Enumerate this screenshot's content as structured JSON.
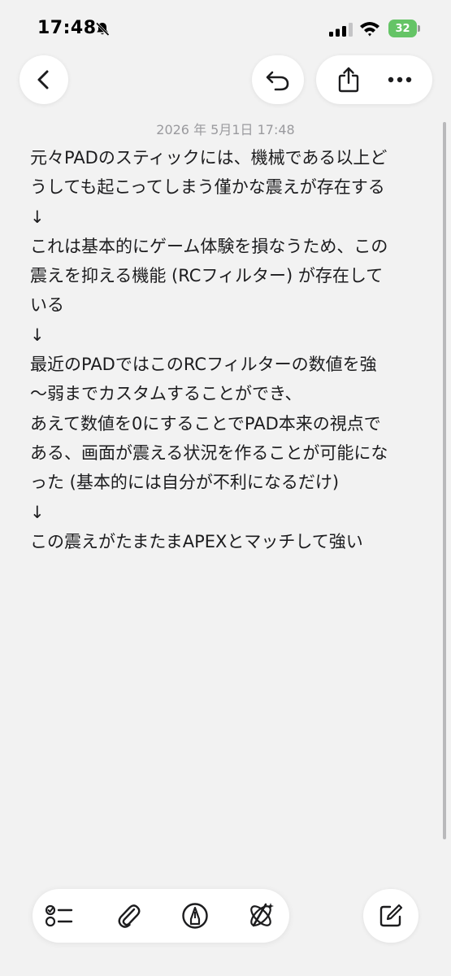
{
  "status_bar": {
    "time": "17:48",
    "battery_level": "32",
    "icons": [
      "bell-slash-icon",
      "cellular-signal-icon",
      "wifi-icon",
      "battery-icon"
    ]
  },
  "nav": {
    "icons": [
      "chevron-left-icon",
      "undo-icon",
      "share-icon",
      "more-icon"
    ]
  },
  "note": {
    "date": "2026 年 5月1日 17:48",
    "lines": [
      "元々PADのスティックには、機械である以上ど",
      "うしても起こってしまう僅かな震えが存在する",
      "↓",
      "これは基本的にゲーム体験を損なうため、この",
      "震えを抑える機能 (RCフィルター) が存在して",
      "いる",
      "↓",
      "最近のPADではこのRCフィルターの数値を強",
      "〜弱までカスタムすることができ、",
      "あえて数値を0にすることでPAD本来の視点で",
      "ある、画面が震える状況を作ることが可能にな",
      "った (基本的には自分が不利になるだけ)",
      "↓",
      "この震えがたまたまAPEXとマッチして強い"
    ]
  },
  "toolbar": {
    "icons": [
      "checklist-icon",
      "paperclip-icon",
      "markup-pen-icon",
      "writing-tools-icon",
      "compose-icon"
    ]
  },
  "colors": {
    "background": "#f2f2f2",
    "text": "#1c1c1e",
    "date_text": "#9a9a9e",
    "battery_green": "#65c466"
  }
}
